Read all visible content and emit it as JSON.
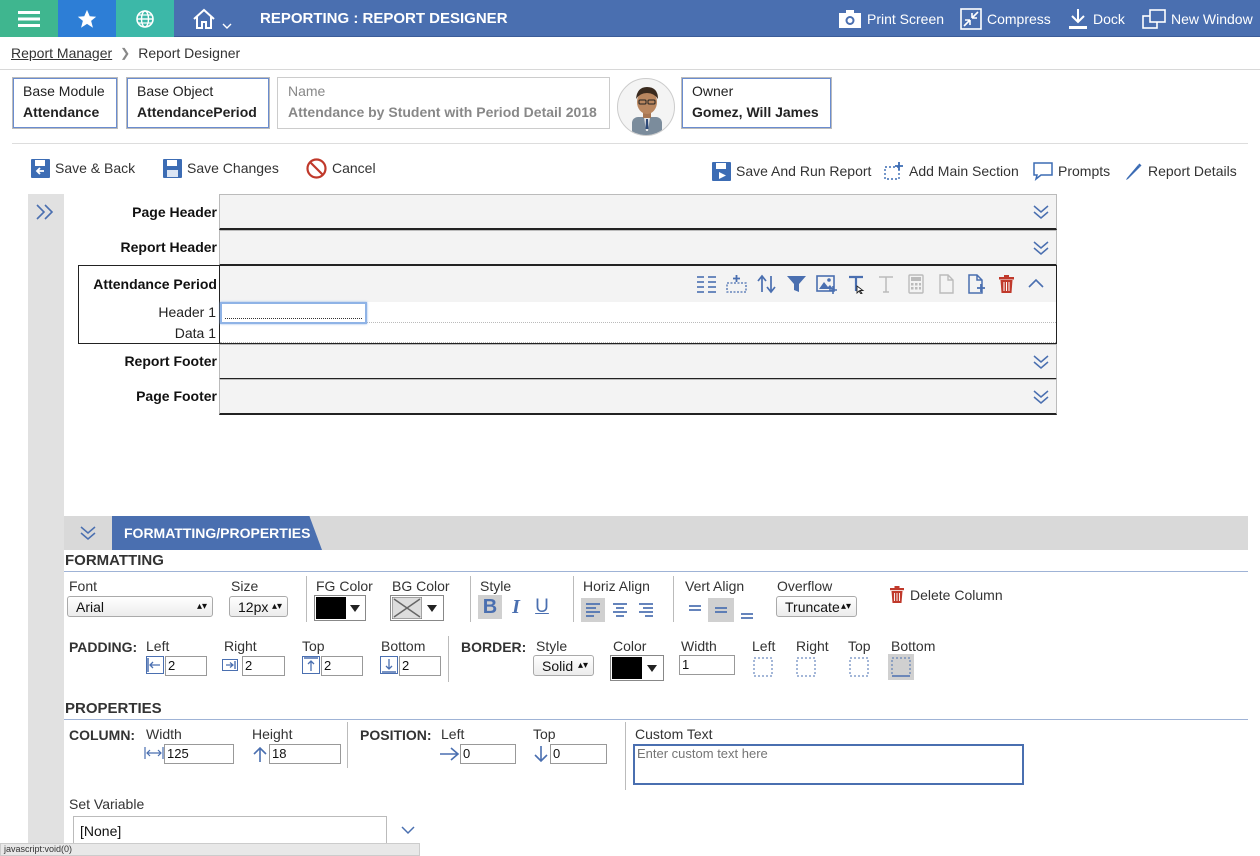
{
  "app": {
    "title": "REPORTING : REPORT DESIGNER"
  },
  "topbar_actions": {
    "print_screen": "Print Screen",
    "compress": "Compress",
    "dock": "Dock",
    "new_window": "New Window"
  },
  "breadcrumb": {
    "parent": "Report Manager",
    "current": "Report Designer"
  },
  "report_info": {
    "base_module_label": "Base Module",
    "base_module_value": "Attendance",
    "base_object_label": "Base Object",
    "base_object_value": "AttendancePeriod",
    "name_label": "Name",
    "name_value": "Attendance by Student with Period Detail 2018",
    "owner_label": "Owner",
    "owner_value": "Gomez, Will James"
  },
  "actions": {
    "save_back": "Save & Back",
    "save_changes": "Save Changes",
    "cancel": "Cancel",
    "save_run": "Save And Run Report",
    "add_main_section": "Add Main Section",
    "prompts": "Prompts",
    "report_details": "Report Details"
  },
  "bands": {
    "page_header": "Page Header",
    "report_header": "Report Header",
    "attendance_period": "Attendance Period",
    "header_1": "Header 1",
    "data_1": "Data 1",
    "report_footer": "Report Footer",
    "page_footer": "Page Footer"
  },
  "props": {
    "tab_label": "FORMATTING/PROPERTIES",
    "formatting_title": "FORMATTING",
    "font_label": "Font",
    "font_value": "Arial",
    "size_label": "Size",
    "size_value": "12px",
    "fg_color_label": "FG Color",
    "bg_color_label": "BG Color",
    "style_label": "Style",
    "bold": "B",
    "italic": "I",
    "underline": "U",
    "horiz_align_label": "Horiz Align",
    "vert_align_label": "Vert Align",
    "overflow_label": "Overflow",
    "overflow_value": "Truncate",
    "delete_column": "Delete Column",
    "padding_label": "PADDING:",
    "left_label": "Left",
    "right_label": "Right",
    "top_label": "Top",
    "bottom_label": "Bottom",
    "padding_left": "2",
    "padding_right": "2",
    "padding_top": "2",
    "padding_bottom": "2",
    "border_label": "BORDER:",
    "border_style_label": "Style",
    "border_style_value": "Solid",
    "border_color_label": "Color",
    "border_width_label": "Width",
    "border_width_value": "1",
    "border_left_label": "Left",
    "border_right_label": "Right",
    "border_top_label": "Top",
    "border_bottom_label": "Bottom",
    "properties_title": "PROPERTIES",
    "column_label": "COLUMN:",
    "width_label": "Width",
    "width_value": "125",
    "height_label": "Height",
    "height_value": "18",
    "position_label": "POSITION:",
    "pos_left_label": "Left",
    "pos_left_value": "0",
    "pos_top_label": "Top",
    "pos_top_value": "0",
    "custom_text_label": "Custom Text",
    "custom_text_placeholder": "Enter custom text here",
    "set_variable_label": "Set Variable",
    "set_variable_value": "[None]"
  },
  "status_bar": "javascript:void(0)",
  "colors": {
    "brand": "#4a6fb0",
    "active_tab_1": "#2d7ed6",
    "active_tab_2": "#3cb8a8",
    "delete": "#c0392b"
  }
}
